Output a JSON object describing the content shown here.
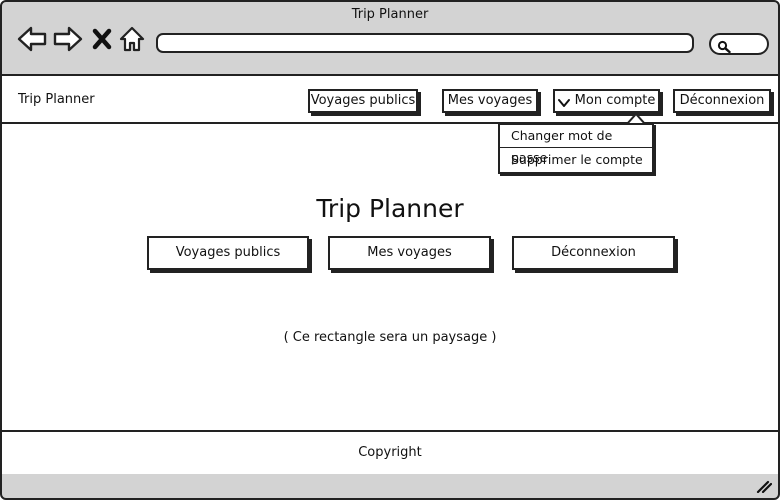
{
  "browser": {
    "title": "Trip Planner",
    "url": ""
  },
  "icons": {
    "back": "arrow-left-icon",
    "forward": "arrow-right-icon",
    "stop": "close-x-icon",
    "home": "home-icon",
    "search": "search-icon",
    "resize": "resize-grip-icon",
    "caret": "chevron-down-icon"
  },
  "topbar": {
    "brand": "Trip Planner",
    "public_trips": "Voyages publics",
    "my_trips": "Mes voyages",
    "account": "Mon compte",
    "logout": "Déconnexion"
  },
  "account_menu": {
    "items": [
      {
        "label": "Changer mot de passe"
      },
      {
        "label": "Supprimer le compte"
      }
    ]
  },
  "main": {
    "title": "Trip Planner",
    "public_trips": "Voyages publics",
    "my_trips": "Mes voyages",
    "logout": "Déconnexion",
    "landscape_note": "( Ce rectangle sera un paysage )"
  },
  "footer": {
    "text": "Copyright"
  },
  "colors": {
    "chrome": "#d3d3d3",
    "outline": "#222222",
    "surface": "#ffffff"
  }
}
